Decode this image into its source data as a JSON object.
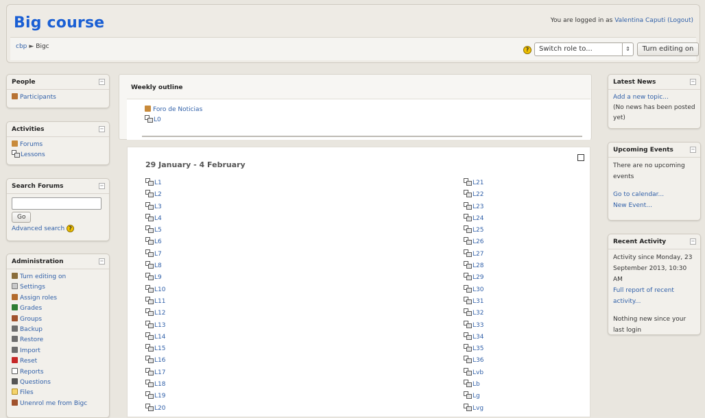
{
  "header": {
    "course_title": "Big course",
    "logged_in_prefix": "You are logged in as ",
    "user_name": "Valentina Caputi",
    "logout_label": "(Logout)",
    "breadcrumb": [
      "cbp",
      "Bigc"
    ],
    "breadcrumb_sep": "►",
    "switch_role_label": "Switch role to...",
    "editing_button_label": "Turn editing on"
  },
  "left_blocks": {
    "people": {
      "title": "People",
      "items": [
        {
          "label": "Participants",
          "icon": "participants-icon"
        }
      ]
    },
    "activities": {
      "title": "Activities",
      "items": [
        {
          "label": "Forums",
          "icon": "forum-icon"
        },
        {
          "label": "Lessons",
          "icon": "lesson-icon"
        }
      ]
    },
    "search": {
      "title": "Search Forums",
      "search_value": "",
      "go_label": "Go",
      "advanced_label": "Advanced search"
    },
    "admin": {
      "title": "Administration",
      "items": [
        {
          "label": "Turn editing on",
          "icon": "edit-icon",
          "color": "#8a6d3b"
        },
        {
          "label": "Settings",
          "icon": "settings-icon",
          "color": "#c9c9c9"
        },
        {
          "label": "Assign roles",
          "icon": "roles-icon",
          "color": "#b36b2c"
        },
        {
          "label": "Grades",
          "icon": "grades-icon",
          "color": "#2e7d32"
        },
        {
          "label": "Groups",
          "icon": "groups-icon",
          "color": "#a0522d"
        },
        {
          "label": "Backup",
          "icon": "backup-icon",
          "color": "#6d6d6d"
        },
        {
          "label": "Restore",
          "icon": "restore-icon",
          "color": "#6d6d6d"
        },
        {
          "label": "Import",
          "icon": "import-icon",
          "color": "#6d6d6d"
        },
        {
          "label": "Reset",
          "icon": "reset-icon",
          "color": "#c62828"
        },
        {
          "label": "Reports",
          "icon": "reports-icon",
          "color": "#555555"
        },
        {
          "label": "Questions",
          "icon": "questions-icon",
          "color": "#555555"
        },
        {
          "label": "Files",
          "icon": "files-icon",
          "color": "#f4d36b"
        },
        {
          "label": "Unenrol me from Bigc",
          "icon": "unenrol-icon",
          "color": "#a0522d"
        }
      ]
    }
  },
  "main": {
    "outline_title": "Weekly outline",
    "section0": [
      {
        "label": "Foro de Noticias",
        "icon": "forum-icon"
      },
      {
        "label": "L0",
        "icon": "lesson-icon"
      }
    ],
    "week_title": "29 January - 4 February",
    "lessons_left": [
      "L1",
      "L2",
      "L3",
      "L4",
      "L5",
      "L6",
      "L7",
      "L8",
      "L9",
      "L10",
      "L11",
      "L12",
      "L13",
      "L14",
      "L15",
      "L16",
      "L17",
      "L18",
      "L19",
      "L20"
    ],
    "lessons_right": [
      "L21",
      "L22",
      "L23",
      "L24",
      "L25",
      "L26",
      "L27",
      "L28",
      "L29",
      "L30",
      "L31",
      "L32",
      "L33",
      "L34",
      "L35",
      "L36",
      "Lvb",
      "Lb",
      "Lg",
      "Lvg"
    ]
  },
  "right_blocks": {
    "news": {
      "title": "Latest News",
      "add_topic": "Add a new topic...",
      "no_news": "(No news has been posted yet)"
    },
    "events": {
      "title": "Upcoming Events",
      "none": "There are no upcoming events",
      "calendar_link": "Go to calendar...",
      "new_event": "New Event..."
    },
    "activity": {
      "title": "Recent Activity",
      "since": "Activity since Monday, 23 September 2013, 10:30 AM",
      "full_report": "Full report of recent activity...",
      "nothing_new": "Nothing new since your last login"
    }
  }
}
